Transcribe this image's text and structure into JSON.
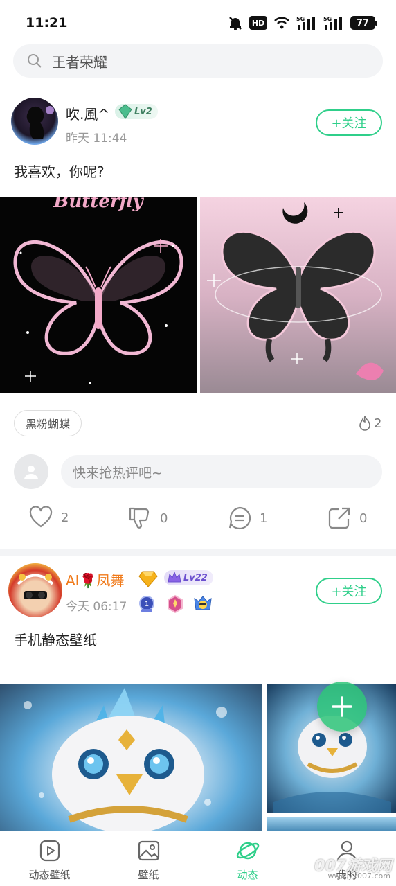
{
  "status_bar": {
    "time": "11:21",
    "hd": "HD",
    "battery": "77"
  },
  "search": {
    "text": "王者荣耀"
  },
  "post1": {
    "username": "吹.風^",
    "level": "Lv2",
    "time": "昨天 11:44",
    "follow_label": "+关注",
    "text": "我喜欢，你呢?",
    "images": [
      {
        "icon": "butterfly-image-dark",
        "caption": "Butterfly"
      },
      {
        "icon": "butterfly-image-pink"
      }
    ],
    "tag": "黑粉蝴蝶",
    "hot_count": "2",
    "comment_placeholder": "快来抢热评吧~",
    "likes": "2",
    "dislikes": "0",
    "comments": "1",
    "shares": "0"
  },
  "post2": {
    "username": "AI🌹凤舞",
    "level": "Lv22",
    "time": "今天 06:17",
    "follow_label": "+关注",
    "text": "手机静态壁纸",
    "images": [
      {
        "icon": "bird-wallpaper-large"
      },
      {
        "icon": "bird-wallpaper-small"
      }
    ]
  },
  "tabs": [
    {
      "label": "动态壁纸",
      "icon": "play-icon"
    },
    {
      "label": "壁纸",
      "icon": "image-icon"
    },
    {
      "label": "动态",
      "icon": "planet-icon",
      "active": true
    },
    {
      "label": "我的",
      "icon": "user-icon"
    }
  ],
  "watermark": {
    "main": "007游戏网",
    "sub": "www.yx007.com"
  },
  "colors": {
    "accent": "#2fcf8a",
    "vip_name": "#f07a1a"
  }
}
